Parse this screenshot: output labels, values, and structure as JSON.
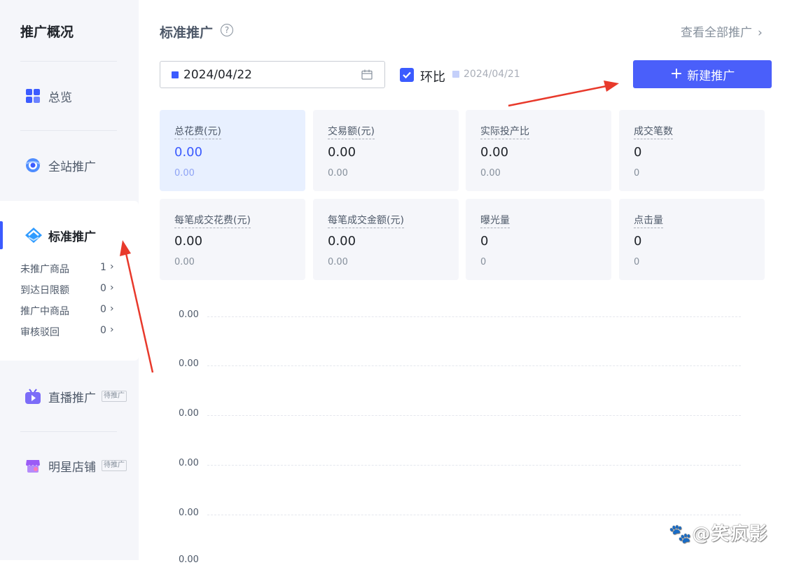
{
  "sidebar": {
    "title": "推广概况",
    "items": [
      {
        "label": "总览",
        "icon": "grid-icon"
      },
      {
        "label": "全站推广",
        "icon": "target-icon"
      },
      {
        "label": "标准推广",
        "icon": "standard-promo-icon"
      },
      {
        "label": "直播推广",
        "icon": "tv-icon",
        "tag": "待推广"
      },
      {
        "label": "明星店铺",
        "icon": "shop-icon",
        "tag": "待推广"
      }
    ],
    "sub_items": [
      {
        "label": "未推广商品",
        "count": "1"
      },
      {
        "label": "到达日限额",
        "count": "0"
      },
      {
        "label": "推广中商品",
        "count": "0"
      },
      {
        "label": "审核驳回",
        "count": "0"
      }
    ]
  },
  "header": {
    "title": "标准推广",
    "help": "?",
    "view_all": "查看全部推广",
    "view_all_chevron": "›"
  },
  "filters": {
    "date": "2024/04/22",
    "compare_label": "环比",
    "compare_checked": true,
    "compare_date": "2024/04/21"
  },
  "new_button": {
    "plus": "+",
    "label": "新建推广"
  },
  "metrics": [
    {
      "label": "总花费(元)",
      "value": "0.00",
      "compare": "0.00",
      "selected": true
    },
    {
      "label": "交易额(元)",
      "value": "0.00",
      "compare": "0.00"
    },
    {
      "label": "实际投产比",
      "value": "0.00",
      "compare": "0.00"
    },
    {
      "label": "成交笔数",
      "value": "0",
      "compare": "0"
    },
    {
      "label": "每笔成交花费(元)",
      "value": "0.00",
      "compare": "0.00"
    },
    {
      "label": "每笔成交金额(元)",
      "value": "0.00",
      "compare": "0.00"
    },
    {
      "label": "曝光量",
      "value": "0",
      "compare": "0"
    },
    {
      "label": "点击量",
      "value": "0",
      "compare": "0"
    }
  ],
  "chart": {
    "y_ticks": [
      "0.00",
      "0.00",
      "0.00",
      "0.00",
      "0.00",
      "0.00"
    ]
  },
  "watermark": "🐾@笑疯影",
  "colors": {
    "accent": "#3b5bff",
    "button": "#4a5ffa",
    "annotation_arrow": "#e8392b",
    "sidebar_bg": "#f5f6fa"
  }
}
